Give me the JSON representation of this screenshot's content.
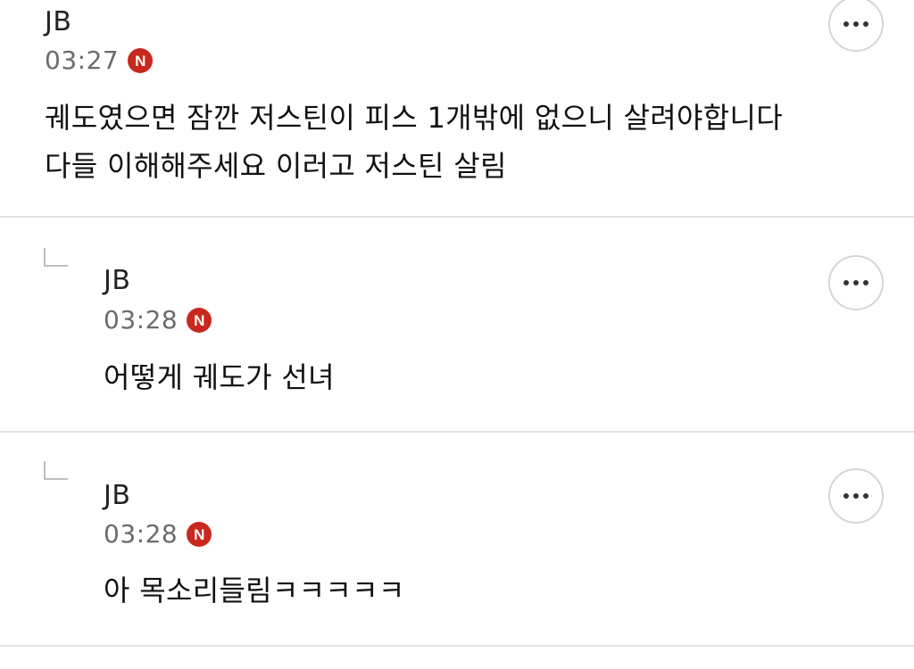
{
  "comments": [
    {
      "author": "JB",
      "time": "03:27",
      "badge": "N",
      "text": "궤도였으면 잠깐 저스틴이 피스 1개밖에 없으니 살려야합니다\n다들 이해해주세요 이러고 저스틴 살림",
      "is_reply": false
    },
    {
      "author": "JB",
      "time": "03:28",
      "badge": "N",
      "text": "어떻게 궤도가 선녀",
      "is_reply": true
    },
    {
      "author": "JB",
      "time": "03:28",
      "badge": "N",
      "text": "아 목소리들림ㅋㅋㅋㅋㅋ",
      "is_reply": true
    }
  ],
  "icons": {
    "more": "more-options-icon",
    "reply": "reply-arrow-icon",
    "badge": "new-badge-icon"
  },
  "colors": {
    "badge": "#c8281e",
    "divider": "#e3e3e3",
    "time": "#6b6b6b"
  }
}
